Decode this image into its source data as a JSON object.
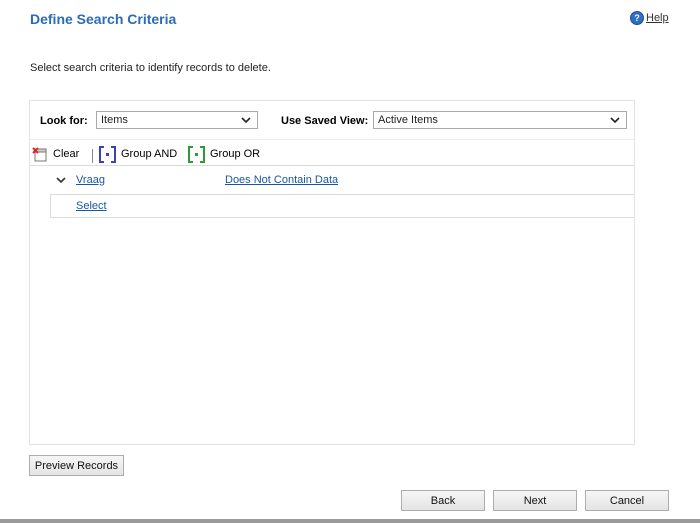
{
  "header": {
    "title": "Define Search Criteria",
    "help_label": "Help"
  },
  "instructions": "Select search criteria to identify records to delete.",
  "query": {
    "look_for_label": "Look for:",
    "look_for_value": "Items",
    "saved_view_label": "Use Saved View:",
    "saved_view_value": "Active Items"
  },
  "toolbar": {
    "clear_label": "Clear",
    "group_and_label": "Group AND",
    "group_or_label": "Group OR"
  },
  "criteria": {
    "field": "Vraag",
    "operator": "Does Not Contain Data",
    "select_label": "Select"
  },
  "buttons": {
    "preview": "Preview Records",
    "back": "Back",
    "next": "Next",
    "cancel": "Cancel"
  },
  "colors": {
    "title": "#2b6cb5",
    "link": "#1a56a6"
  }
}
